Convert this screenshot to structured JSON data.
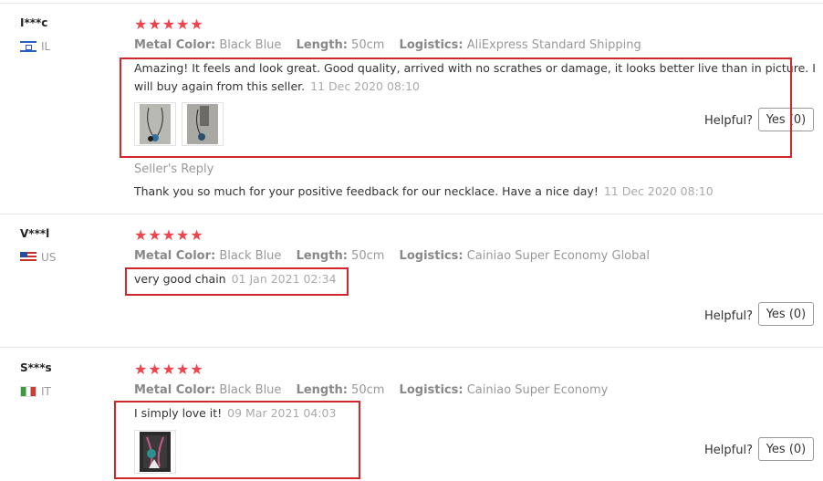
{
  "reviews": [
    {
      "user": "I***c",
      "country": "IL",
      "stars": "★★★★★",
      "props": {
        "color_label": "Metal Color:",
        "color_value": "Black Blue",
        "length_label": "Length:",
        "length_value": "50cm",
        "logistics_label": "Logistics:",
        "logistics_value": "AliExpress Standard Shipping"
      },
      "text_line1": "Amazing! It feels and look great. Good quality, arrived with no scrathes or damage, it looks better live than in picture. I",
      "text_line2": "will buy again from this seller.",
      "date": "11 Dec 2020 08:10",
      "helpful_label": "Helpful?",
      "yes_label": "Yes (0)",
      "seller_reply_label": "Seller's Reply",
      "seller_reply_text": "Thank you so much for your positive feedback for our necklace. Have a nice day!",
      "seller_reply_date": "11 Dec 2020 08:10"
    },
    {
      "user": "V***l",
      "country": "US",
      "stars": "★★★★★",
      "props": {
        "color_label": "Metal Color:",
        "color_value": "Black Blue",
        "length_label": "Length:",
        "length_value": "50cm",
        "logistics_label": "Logistics:",
        "logistics_value": "Cainiao Super Economy Global"
      },
      "text_line1": "very good chain",
      "date": "01 Jan 2021 02:34",
      "helpful_label": "Helpful?",
      "yes_label": "Yes (0)"
    },
    {
      "user": "S***s",
      "country": "IT",
      "stars": "★★★★★",
      "props": {
        "color_label": "Metal Color:",
        "color_value": "Black Blue",
        "length_label": "Length:",
        "length_value": "50cm",
        "logistics_label": "Logistics:",
        "logistics_value": "Cainiao Super Economy"
      },
      "text_line1": "I simply love it!",
      "date": "09 Mar 2021 04:03",
      "helpful_label": "Helpful?",
      "yes_label": "Yes (0)"
    }
  ],
  "colors": {
    "star": "#f0434d",
    "highlight_box": "#d0262c"
  }
}
